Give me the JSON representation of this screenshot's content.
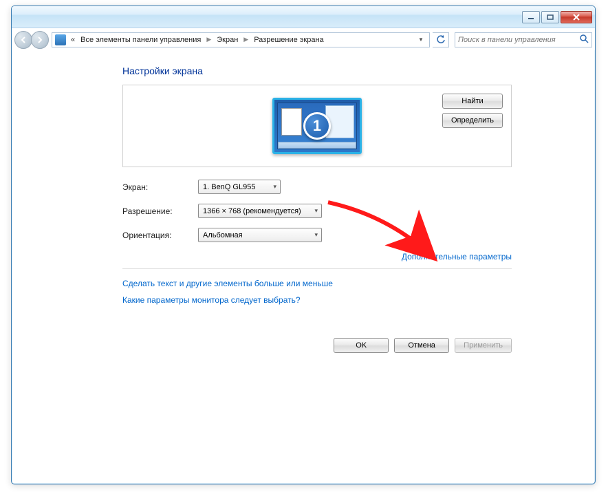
{
  "breadcrumb": {
    "root_marker": "«",
    "item1": "Все элементы панели управления",
    "item2": "Экран",
    "item3": "Разрешение экрана"
  },
  "search": {
    "placeholder": "Поиск в панели управления"
  },
  "heading": "Настройки экрана",
  "preview": {
    "display_number": "1",
    "find_button": "Найти",
    "detect_button": "Определить"
  },
  "form": {
    "display_label": "Экран:",
    "display_value": "1. BenQ GL955",
    "resolution_label": "Разрешение:",
    "resolution_value": "1366 × 768 (рекомендуется)",
    "orientation_label": "Ориентация:",
    "orientation_value": "Альбомная"
  },
  "links": {
    "advanced": "Дополнительные параметры",
    "text_size": "Сделать текст и другие элементы больше или меньше",
    "which_monitor": "Какие параметры монитора следует выбрать?"
  },
  "buttons": {
    "ok": "OK",
    "cancel": "Отмена",
    "apply": "Применить"
  }
}
